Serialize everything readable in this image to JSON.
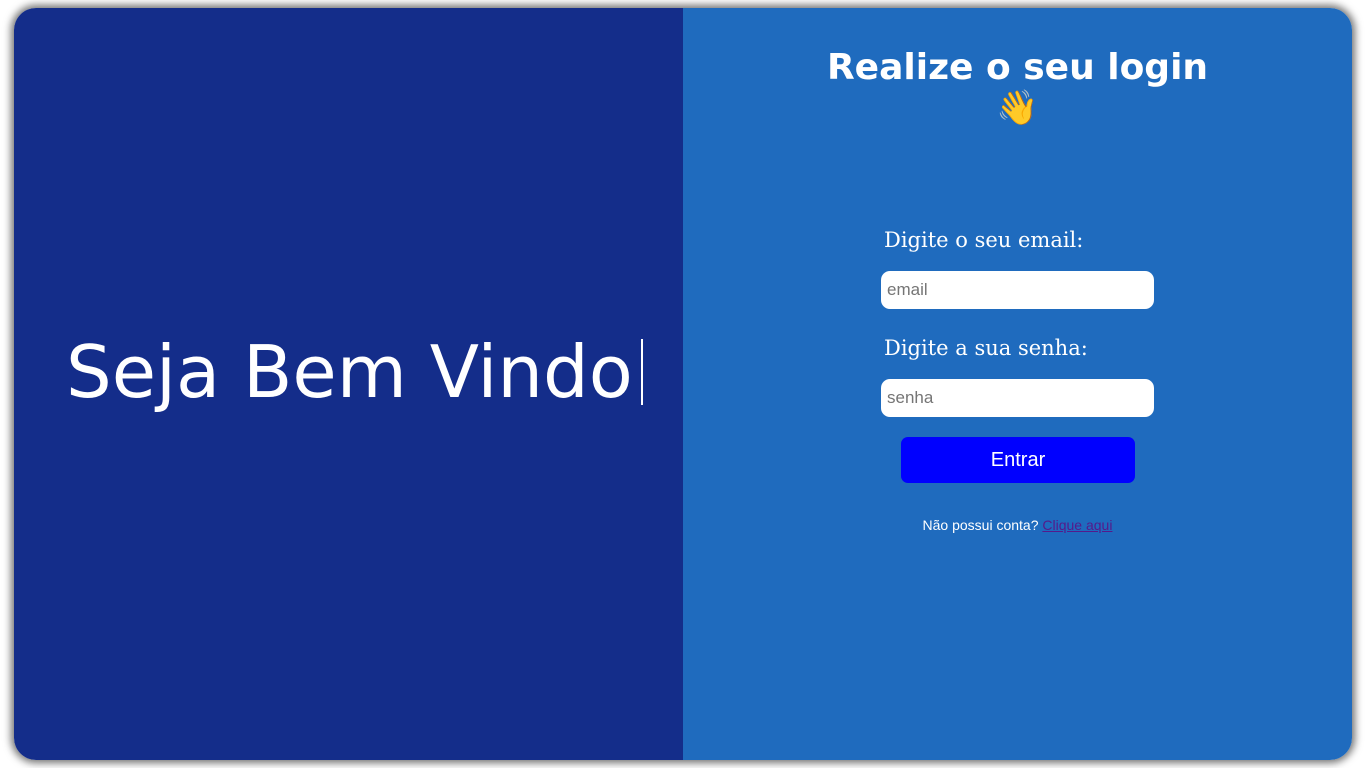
{
  "left": {
    "welcome_text": "Seja Bem Vindo"
  },
  "login": {
    "title": "Realize o seu login",
    "wave_icon": "👋",
    "email_label": "Digite o seu email:",
    "email_placeholder": "email",
    "email_value": "",
    "password_label": "Digite a sua senha:",
    "password_placeholder": "senha",
    "password_value": "",
    "submit_label": "Entrar",
    "signup_prompt": "Não possui conta?",
    "signup_link": "Clique aqui"
  },
  "colors": {
    "left_panel_bg": "#142d8a",
    "right_panel_bg": "#1f6bbe",
    "button_bg": "#0000ff",
    "link": "#551a8b"
  },
  "icons": {
    "wave": "waving-hand-icon",
    "caret": "text-cursor-icon"
  }
}
